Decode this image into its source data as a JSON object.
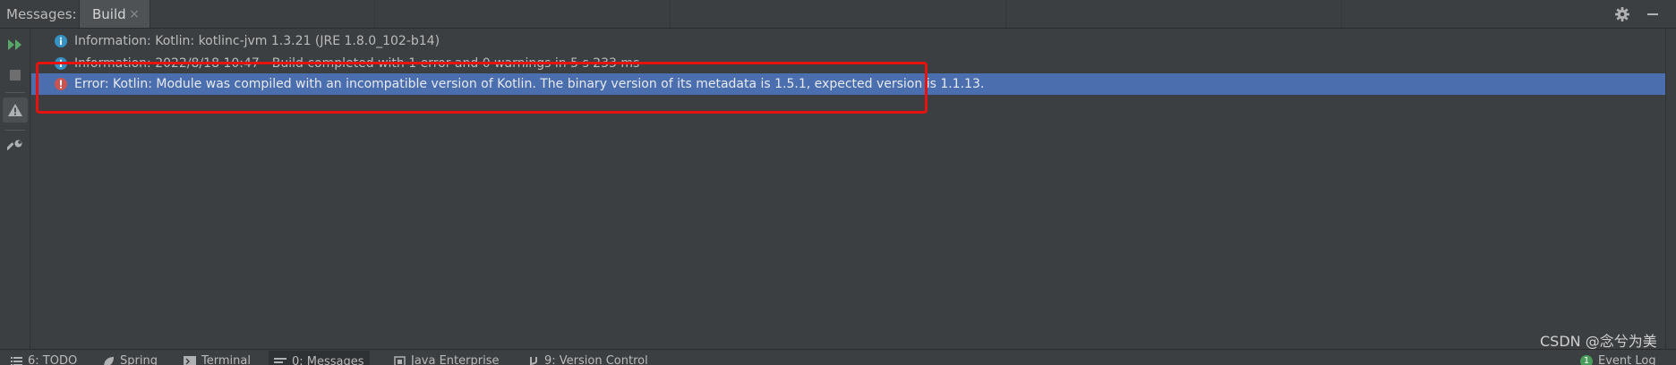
{
  "header": {
    "title": "Messages:",
    "tab_label": "Build",
    "close_glyph": "×",
    "actions": [
      {
        "icon": "gear-icon"
      },
      {
        "icon": "minimize-icon"
      }
    ]
  },
  "toolbar": {
    "buttons": [
      {
        "icon": "rerun-icon",
        "color": "#59a869"
      },
      {
        "icon": "stop-icon",
        "color": "#6e6e6e"
      },
      {
        "icon": "warning-filter-icon",
        "active": true
      },
      {
        "icon": "wrench-icon"
      }
    ]
  },
  "messages": [
    {
      "type": "info",
      "text": "Information: Kotlin: kotlinc-jvm 1.3.21 (JRE 1.8.0_102-b14)"
    },
    {
      "type": "info",
      "text": "Information: 2022/8/18 10:47 - Build completed with 1 error and 0 warnings in 5 s 233 ms"
    },
    {
      "type": "error",
      "text": "Error: Kotlin: Module was compiled with an incompatible version of Kotlin. The binary version of its metadata is 1.5.1, expected version is 1.1.13.",
      "selected": true
    }
  ],
  "bottom_bar": {
    "items": [
      {
        "label": "6: TODO",
        "icon": "list-icon"
      },
      {
        "label": "Spring",
        "icon": "spring-icon"
      },
      {
        "label": "Terminal",
        "icon": "terminal-icon"
      },
      {
        "label": "0: Messages",
        "icon": "messages-icon",
        "active": true
      },
      {
        "label": "Java Enterprise",
        "icon": "java-enterprise-icon"
      },
      {
        "label": "9: Version Control",
        "icon": "vcs-icon"
      }
    ],
    "event_log": {
      "label": "Event Log",
      "badge": "1"
    }
  },
  "watermark": "CSDN @念兮为美",
  "colors": {
    "background": "#3c3f41",
    "selection": "#4b6eaf",
    "info": "#3592c4",
    "error": "#c75450",
    "highlight": "#e8130f"
  }
}
